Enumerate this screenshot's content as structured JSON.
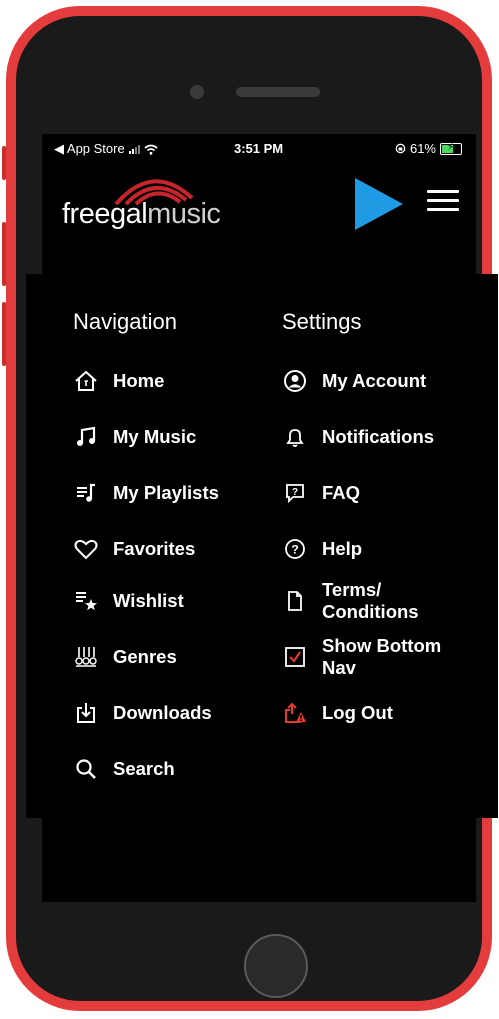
{
  "status_bar": {
    "back_label": "◀ App Store",
    "time": "3:51 PM",
    "battery_percent": "61%"
  },
  "logo": {
    "part1": "freegal",
    "part2": "music"
  },
  "navigation": {
    "heading": "Navigation",
    "items": [
      {
        "label": "Home",
        "icon": "home-icon"
      },
      {
        "label": "My Music",
        "icon": "music-note-icon"
      },
      {
        "label": "My Playlists",
        "icon": "playlist-icon"
      },
      {
        "label": "Favorites",
        "icon": "heart-icon"
      },
      {
        "label": "Wishlist",
        "icon": "wishlist-star-icon"
      },
      {
        "label": "Genres",
        "icon": "genres-icon"
      },
      {
        "label": "Downloads",
        "icon": "download-icon"
      },
      {
        "label": "Search",
        "icon": "search-icon"
      }
    ]
  },
  "settings": {
    "heading": "Settings",
    "items": [
      {
        "label": "My Account",
        "icon": "account-icon"
      },
      {
        "label": "Notifications",
        "icon": "bell-icon"
      },
      {
        "label": "FAQ",
        "icon": "faq-icon"
      },
      {
        "label": "Help",
        "icon": "help-icon"
      },
      {
        "label": "Terms/ Conditions",
        "label_line1": "Terms/",
        "label_line2": "Conditions",
        "icon": "document-icon"
      },
      {
        "label": "Show Bottom Nav",
        "label_line1": "Show Bottom",
        "label_line2": "Nav",
        "icon": "checkbox-icon",
        "checked": true
      },
      {
        "label": "Log Out",
        "icon": "logout-icon"
      }
    ]
  },
  "colors": {
    "phone_frame": "#e43c3c",
    "accent_arrow": "#1f9be3",
    "logout_red": "#e23b2e",
    "battery_green": "#4cd964"
  }
}
